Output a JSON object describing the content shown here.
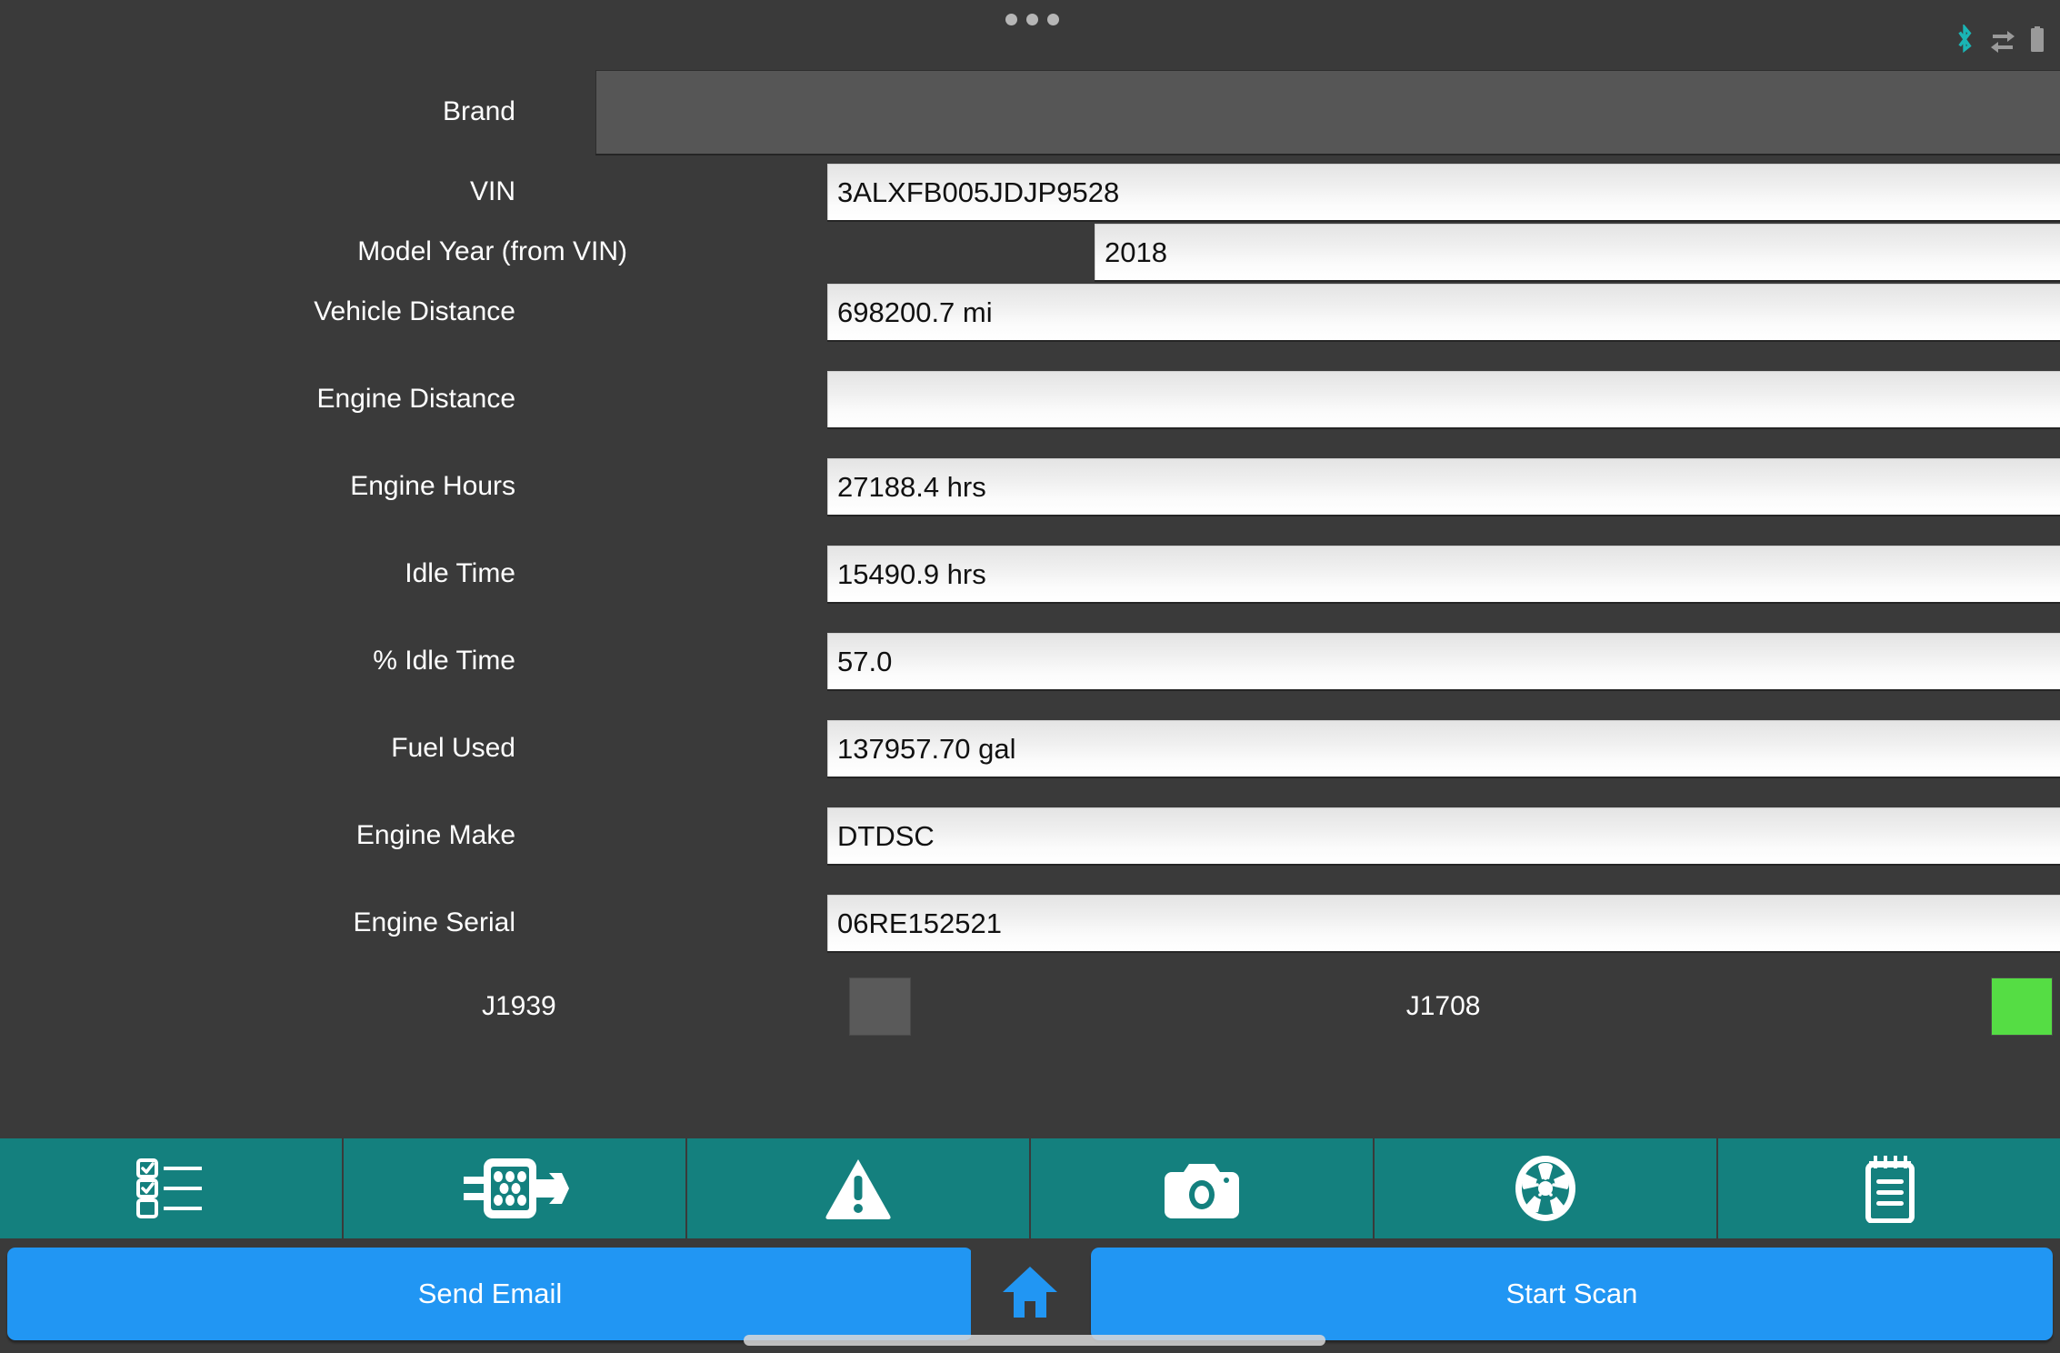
{
  "statusbar": {
    "dots_count": 3,
    "icons": [
      {
        "name": "bluetooth-icon",
        "color": "#1ab5b5"
      },
      {
        "name": "data-transfer-icon",
        "color": "#9a9a9a"
      },
      {
        "name": "battery-icon",
        "color": "#9a9a9a"
      }
    ]
  },
  "form": {
    "fields": [
      {
        "label": "Brand",
        "value": "",
        "type": "box"
      },
      {
        "label": "VIN",
        "value": "3ALXFB005JDJP9528",
        "type": "text"
      },
      {
        "label": "Model Year (from VIN)",
        "value": "2018",
        "type": "text"
      },
      {
        "label": "Vehicle Distance",
        "value": "698200.7 mi",
        "type": "text"
      },
      {
        "label": "Engine Distance",
        "value": "",
        "type": "text"
      },
      {
        "label": "Engine Hours",
        "value": "27188.4 hrs",
        "type": "text"
      },
      {
        "label": "Idle Time",
        "value": "15490.9 hrs",
        "type": "text"
      },
      {
        "label": "% Idle Time",
        "value": "57.0",
        "type": "text"
      },
      {
        "label": "Fuel Used",
        "value": "137957.70 gal",
        "type": "text"
      },
      {
        "label": "Engine Make",
        "value": "DTDSC",
        "type": "text"
      },
      {
        "label": "Engine Serial",
        "value": "06RE152521",
        "type": "text"
      }
    ]
  },
  "protocols": [
    {
      "label": "J1939",
      "status": "inactive",
      "color": "#5a5a5a"
    },
    {
      "label": "J1708",
      "status": "active",
      "color": "#55dd44"
    }
  ],
  "toolbar": {
    "background": "#14807e",
    "items": [
      {
        "name": "checklist-icon"
      },
      {
        "name": "connector-plug-icon"
      },
      {
        "name": "warning-triangle-icon"
      },
      {
        "name": "camera-icon"
      },
      {
        "name": "wheel-icon"
      },
      {
        "name": "notepad-icon"
      }
    ]
  },
  "bottom": {
    "send_email_label": "Send Email",
    "start_scan_label": "Start Scan",
    "home_icon": "home-icon",
    "button_color": "#2196f3"
  }
}
